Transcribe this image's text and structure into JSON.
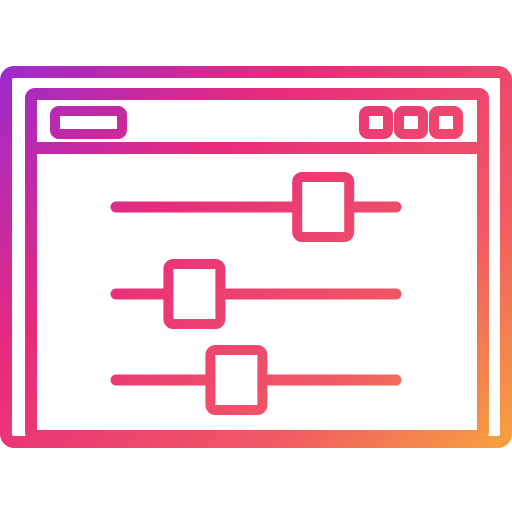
{
  "icon": {
    "name": "browser-window-sliders-icon",
    "gradient": {
      "start": "#8a2be2",
      "mid1": "#e82a7c",
      "mid2": "#f15a63",
      "end": "#f7b733"
    }
  },
  "window": {
    "title_bar": {
      "tab_icon": "tab-pill-icon",
      "controls": [
        "window-control-1-icon",
        "window-control-2-icon",
        "window-control-3-icon"
      ]
    }
  },
  "sliders": [
    {
      "name": "slider-1",
      "value": 0.74
    },
    {
      "name": "slider-2",
      "value": 0.28
    },
    {
      "name": "slider-3",
      "value": 0.43
    }
  ]
}
